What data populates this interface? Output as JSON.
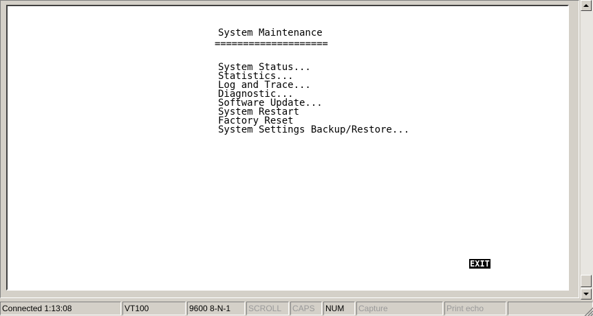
{
  "screen": {
    "title": "System Maintenance",
    "underline": "====================",
    "menu": [
      "System Status...",
      "Statistics...",
      "Log and Trace...",
      "Diagnostic...",
      "Software Update...",
      "System Restart",
      "Factory Reset",
      "System Settings Backup/Restore..."
    ],
    "exit_label": "EXIT"
  },
  "statusbar": {
    "connected": "Connected 1:13:08",
    "emulation": "VT100",
    "port_settings": "9600 8-N-1",
    "scroll": "SCROLL",
    "caps": "CAPS",
    "num": "NUM",
    "capture": "Capture",
    "print_echo": "Print echo"
  },
  "colors": {
    "background": "#d4d0c8",
    "terminal": "#ffffff",
    "highlight": "#000000",
    "disabled_text": "#9a9a9a"
  },
  "icons": {
    "scroll_up": "scroll-up-arrow",
    "scroll_down": "scroll-down-arrow",
    "resize": "resize-grip"
  }
}
